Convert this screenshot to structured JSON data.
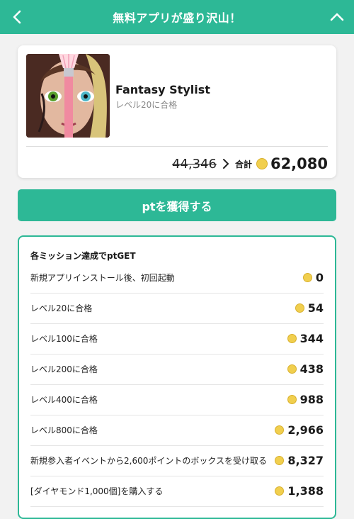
{
  "header": {
    "title": "無料アプリが盛り沢山！",
    "back_icon": "chevron-left-icon",
    "up_icon": "chevron-up-icon"
  },
  "app_card": {
    "name": "Fantasy Stylist",
    "condition": "レベル20に合格",
    "old_points": "44,346",
    "total_label": "合計",
    "total_points": "62,080"
  },
  "earn_button": {
    "label": "ptを獲得する"
  },
  "missions": {
    "title": "各ミッション達成でptGET",
    "items": [
      {
        "label": "新規アプリインストール後、初回起動",
        "points": "0"
      },
      {
        "label": "レベル20に合格",
        "points": "54"
      },
      {
        "label": "レベル100に合格",
        "points": "344"
      },
      {
        "label": "レベル200に合格",
        "points": "438"
      },
      {
        "label": "レベル400に合格",
        "points": "988"
      },
      {
        "label": "レベル800に合格",
        "points": "2,966"
      },
      {
        "label": "新規参入者イベントから2,600ポイントのボックスを受け取る",
        "points": "8,327"
      },
      {
        "label": "[ダイヤモンド1,000個]を購入する",
        "points": "1,388"
      }
    ]
  },
  "colors": {
    "accent": "#2db896",
    "coin": "#f1cf4e"
  }
}
